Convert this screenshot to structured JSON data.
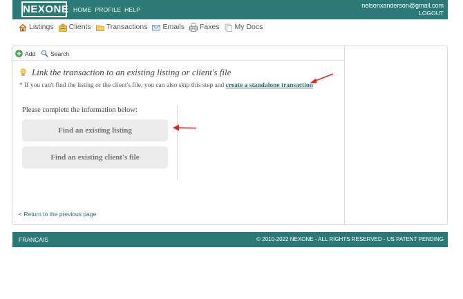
{
  "header": {
    "logo": "NEXONE",
    "nav": [
      "HOME",
      "PROFILE",
      "HELP"
    ],
    "email": "nelsonxanderson@gmail.com",
    "logout": "LOGOUT"
  },
  "modules": [
    {
      "label": "Listings",
      "icon": "house-icon"
    },
    {
      "label": "Clients",
      "icon": "client-icon"
    },
    {
      "label": "Transactions",
      "icon": "folder-icon"
    },
    {
      "label": "Emails",
      "icon": "envelope-icon"
    },
    {
      "label": "Faxes",
      "icon": "fax-icon"
    },
    {
      "label": "My Docs",
      "icon": "documents-icon"
    }
  ],
  "toolbar": {
    "add": "Add",
    "search": "Search"
  },
  "main": {
    "heading": "Link the transaction to an existing listing or client's file",
    "note_prefix": "* If you can't find the listing or the client's file, you can also skip this step and",
    "note_link": "create a standalone transaction",
    "complete": "Please complete the information below:",
    "btn_listing": "Find an existing listing",
    "btn_client": "Find an existing client's file",
    "back": "< Return to the previous page"
  },
  "footer": {
    "lang": "FRANÇAIS",
    "copyright": "© 2010-2022 NEXONE - ALL RIGHTS RESERVED - US PATENT PENDING"
  },
  "colors": {
    "brand": "#2b7a78",
    "link": "#2b6b69",
    "arrow": "#e02424"
  }
}
